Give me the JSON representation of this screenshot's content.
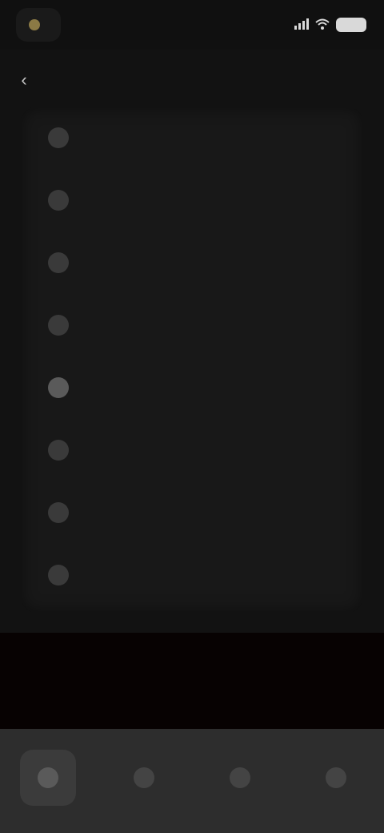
{
  "status_bar": {
    "brand_label": "",
    "time": "",
    "icons": [
      "signal-icon",
      "wifi-icon",
      "battery-icon"
    ]
  },
  "header": {
    "title": "",
    "back_icon": "back-arrow-icon"
  },
  "list": {
    "items": [
      {
        "label": "",
        "icon": "circle-icon"
      },
      {
        "label": "",
        "icon": "circle-icon"
      },
      {
        "label": "",
        "icon": "circle-icon"
      },
      {
        "label": "",
        "icon": "circle-icon"
      },
      {
        "label": "",
        "icon": "circle-icon"
      },
      {
        "label": "",
        "icon": "circle-icon"
      },
      {
        "label": "",
        "icon": "circle-icon"
      },
      {
        "label": "",
        "icon": "circle-icon"
      }
    ]
  },
  "footer": {
    "save_label": ""
  },
  "bottom_nav": {
    "items": [
      {
        "name": "nav-item-1",
        "active": true
      },
      {
        "name": "nav-item-2",
        "active": false
      },
      {
        "name": "nav-item-3",
        "active": false
      },
      {
        "name": "nav-item-4",
        "active": false
      }
    ]
  },
  "colors": {
    "background": "#121212",
    "sheet": "#181818",
    "save_bar": "#070202",
    "bottom_nav": "#2d2d2d",
    "brand_accent": "#8b7a45"
  }
}
